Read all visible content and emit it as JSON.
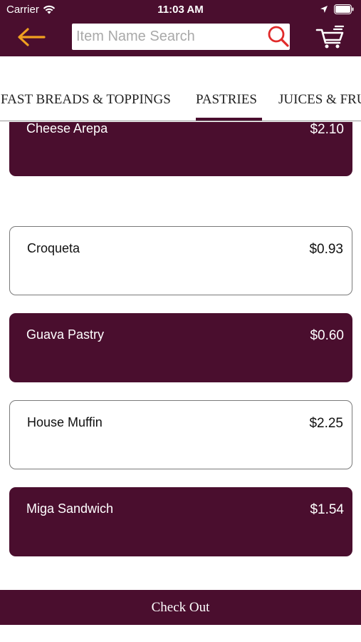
{
  "status_bar": {
    "carrier": "Carrier",
    "time": "11:03 AM"
  },
  "header": {
    "back_icon": "arrow-left-icon",
    "search": {
      "placeholder": "Item Name Search",
      "value": ""
    },
    "cart_icon": "shopping-cart-icon"
  },
  "colors": {
    "brand": "#4a0e2e",
    "accent": "#f0a020",
    "search_icon": "#e02a2a"
  },
  "tabs": [
    {
      "label": "FAST BREADS & TOPPINGS",
      "active": false
    },
    {
      "label": "PASTRIES",
      "active": true
    },
    {
      "label": "JUICES & FRU",
      "active": false
    }
  ],
  "items": [
    {
      "name": "Cheese Arepa",
      "price": "$2.10"
    },
    {
      "name": "Croqueta",
      "price": "$0.93"
    },
    {
      "name": "Guava Pastry",
      "price": "$0.60"
    },
    {
      "name": "House Muffin",
      "price": "$2.25"
    },
    {
      "name": "Miga Sandwich",
      "price": "$1.54"
    }
  ],
  "footer": {
    "checkout_label": "Check Out"
  }
}
